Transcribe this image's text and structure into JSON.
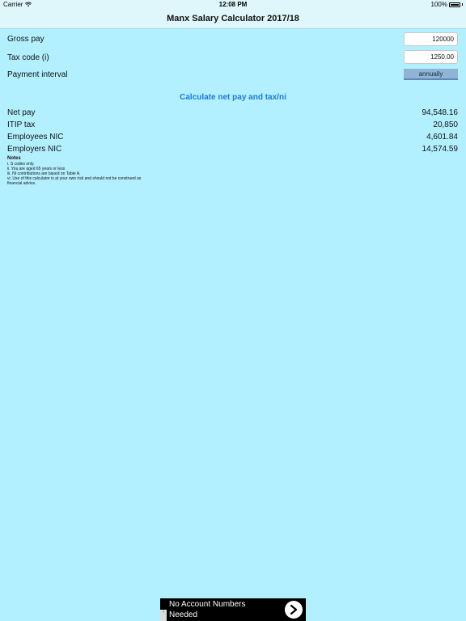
{
  "status_bar": {
    "carrier": "Carrier",
    "time": "12:08 PM",
    "battery": "100%"
  },
  "nav": {
    "title": "Manx Salary Calculator 2017/18"
  },
  "form": {
    "gross_pay_label": "Gross pay",
    "gross_pay_value": "120000",
    "tax_code_label": "Tax code (i)",
    "tax_code_value": "1250.00",
    "payment_interval_label": "Payment interval",
    "payment_interval_value": "annually"
  },
  "calculate_label": "Calculate net pay and tax/ni",
  "results": {
    "net_pay_label": "Net pay",
    "net_pay_value": "94,548.16",
    "itip_tax_label": "ITIP tax",
    "itip_tax_value": "20,850",
    "employees_nic_label": "Employees NIC",
    "employees_nic_value": "4,601.84",
    "employers_nic_label": "Employers NIC",
    "employers_nic_value": "14,574.59"
  },
  "notes": {
    "title": "Notes",
    "items": [
      "i. S codes only.",
      "ii. You are aged 65 years or less",
      "iii. NI contributions are based on Table A.",
      "vi. Use of this calculator is at your own risk and should not be construed as financial advice."
    ]
  },
  "ad": {
    "text": "No Account Numbers Needed",
    "choices": "i"
  },
  "colors": {
    "background": "#b3f0ff",
    "accent": "#1a7ad8",
    "dropdown": "#8fb4d6"
  }
}
